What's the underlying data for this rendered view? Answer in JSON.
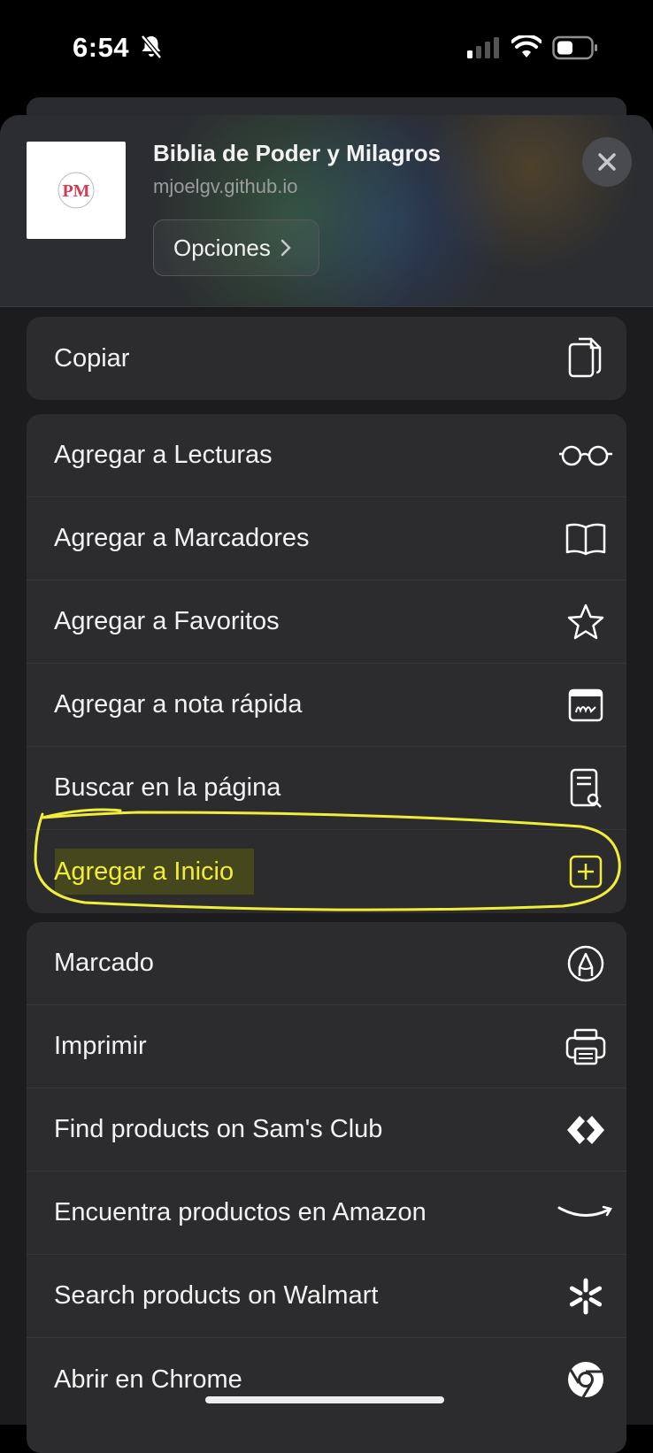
{
  "status_bar": {
    "time": "6:54"
  },
  "share_sheet": {
    "title": "Biblia de Poder y Milagros",
    "domain": "mjoelgv.github.io",
    "options_label": "Opciones",
    "thumbnail_text": "PM"
  },
  "groups": [
    [
      {
        "label": "Copiar",
        "icon": "copy-icon"
      }
    ],
    [
      {
        "label": "Agregar a Lecturas",
        "icon": "glasses-icon"
      },
      {
        "label": "Agregar a Marcadores",
        "icon": "book-icon"
      },
      {
        "label": "Agregar a Favoritos",
        "icon": "star-icon"
      },
      {
        "label": "Agregar a nota rápida",
        "icon": "quick-note-icon"
      },
      {
        "label": "Buscar en la página",
        "icon": "find-on-page-icon"
      },
      {
        "label": "Agregar a Inicio",
        "icon": "add-square-icon"
      }
    ],
    [
      {
        "label": "Marcado",
        "icon": "markup-icon"
      },
      {
        "label": "Imprimir",
        "icon": "printer-icon"
      },
      {
        "label": "Find products on Sam's Club",
        "icon": "sams-club-icon"
      },
      {
        "label": "Encuentra productos en Amazon",
        "icon": "amazon-smile-icon"
      },
      {
        "label": "Search products on Walmart",
        "icon": "walmart-spark-icon"
      },
      {
        "label": "Abrir en Chrome",
        "icon": "chrome-icon"
      }
    ]
  ],
  "colors": {
    "highlight": "#f0ee3a",
    "sheet": "#1c1c1e",
    "row": "#2c2c2e"
  }
}
